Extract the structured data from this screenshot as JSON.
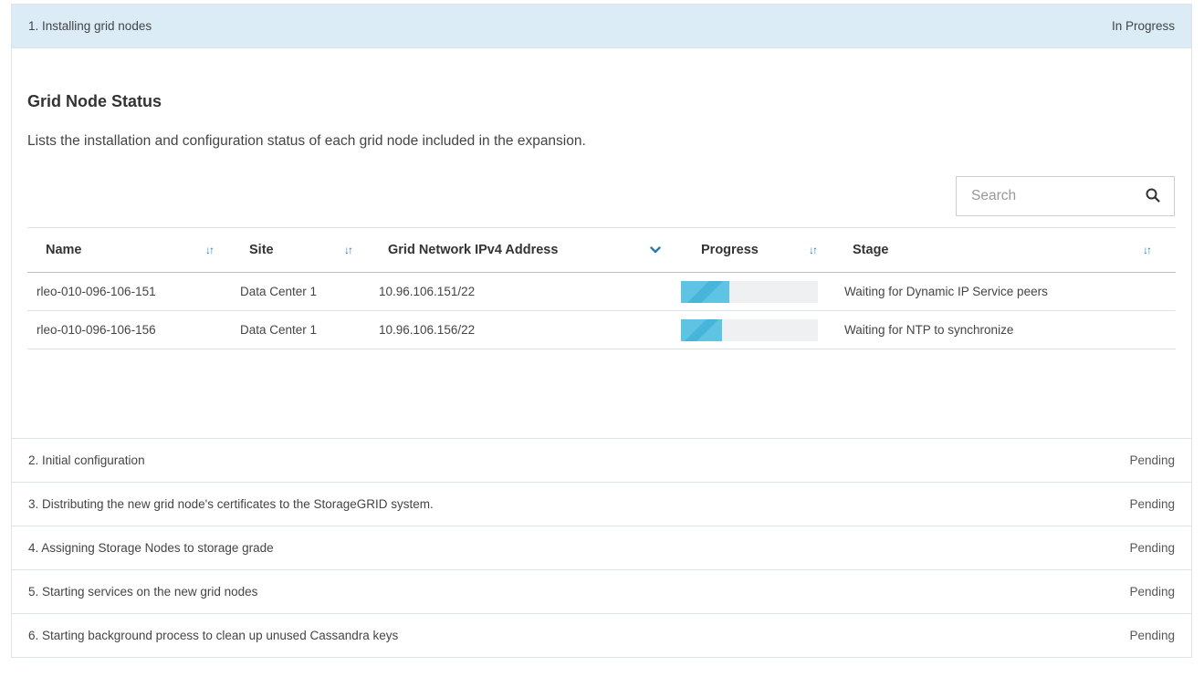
{
  "steps": [
    {
      "label": "1. Installing grid nodes",
      "status": "In Progress"
    },
    {
      "label": "2. Initial configuration",
      "status": "Pending"
    },
    {
      "label": "3. Distributing the new grid node's certificates to the StorageGRID system.",
      "status": "Pending"
    },
    {
      "label": "4. Assigning Storage Nodes to storage grade",
      "status": "Pending"
    },
    {
      "label": "5. Starting services on the new grid nodes",
      "status": "Pending"
    },
    {
      "label": "6. Starting background process to clean up unused Cassandra keys",
      "status": "Pending"
    }
  ],
  "grid_status": {
    "title": "Grid Node Status",
    "description": "Lists the installation and configuration status of each grid node included in the expansion.",
    "search_placeholder": "Search",
    "columns": {
      "name": "Name",
      "site": "Site",
      "ipv4": "Grid Network IPv4 Address",
      "progress": "Progress",
      "stage": "Stage"
    },
    "rows": [
      {
        "name": "rleo-010-096-106-151",
        "site": "Data Center 1",
        "ipv4": "10.96.106.151/22",
        "progress": 0.35,
        "stage": "Waiting for Dynamic IP Service peers"
      },
      {
        "name": "rleo-010-096-106-156",
        "site": "Data Center 1",
        "ipv4": "10.96.106.156/22",
        "progress": 0.3,
        "stage": "Waiting for NTP to synchronize"
      }
    ]
  },
  "icons": {
    "search": "search-icon",
    "sort": "sort-icon",
    "chevron": "chevron-down-icon"
  },
  "colors": {
    "active_header": "#dcecf6",
    "accent": "#2a7ab0",
    "progress_fill": "#5fc3e4"
  }
}
